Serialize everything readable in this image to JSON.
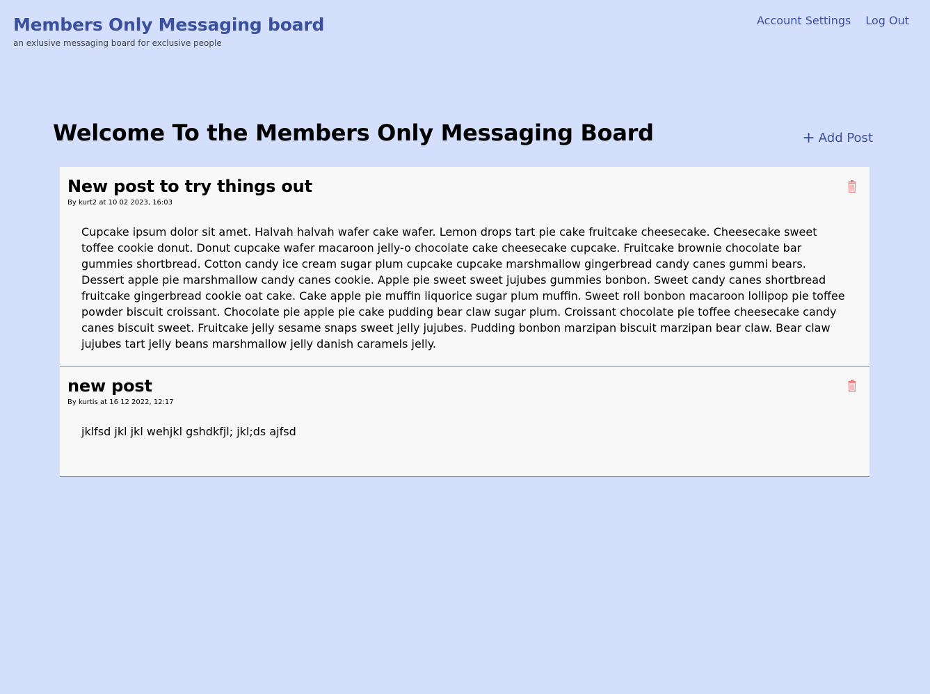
{
  "header": {
    "title": "Members Only Messaging board",
    "tagline": "an exlusive messaging board for exclusive people"
  },
  "nav": {
    "account_settings": "Account Settings",
    "log_out": "Log Out"
  },
  "main": {
    "heading": "Welcome To the Members Only Messaging Board",
    "add_post_icon": "+",
    "add_post_label": "Add Post"
  },
  "posts": [
    {
      "title": "New post to try things out",
      "meta": "By kurt2 at 10 02 2023, 16:03",
      "body": "Cupcake ipsum dolor sit amet. Halvah halvah wafer cake wafer. Lemon drops tart pie cake fruitcake cheesecake. Cheesecake sweet toffee cookie donut. Donut cupcake wafer macaroon jelly-o chocolate cake cheesecake cupcake. Fruitcake brownie chocolate bar gummies shortbread. Cotton candy ice cream sugar plum cupcake cupcake marshmallow gingerbread candy canes gummi bears. Dessert apple pie marshmallow candy canes cookie. Apple pie sweet sweet jujubes gummies bonbon. Sweet candy canes shortbread fruitcake gingerbread cookie oat cake. Cake apple pie muffin liquorice sugar plum muffin. Sweet roll bonbon macaroon lollipop pie toffee powder biscuit croissant. Chocolate pie apple pie cake pudding bear claw sugar plum. Croissant chocolate pie toffee cheesecake candy canes biscuit sweet. Fruitcake jelly sesame snaps sweet jelly jujubes. Pudding bonbon marzipan biscuit marzipan bear claw. Bear claw jujubes tart jelly beans marshmallow jelly danish caramels jelly."
    },
    {
      "title": "new post",
      "meta": "By kurtis at 16 12 2022, 12:17",
      "body": "jklfsd jkl jkl wehjkl gshdkfjl; jkl;ds ajfsd"
    }
  ],
  "icons": {
    "delete": "trash-icon",
    "add": "plus-icon"
  },
  "colors": {
    "background": "#d4dffb",
    "accent": "#3b4f9f",
    "delete": "#e8787a",
    "card": "#f8f8f8"
  }
}
